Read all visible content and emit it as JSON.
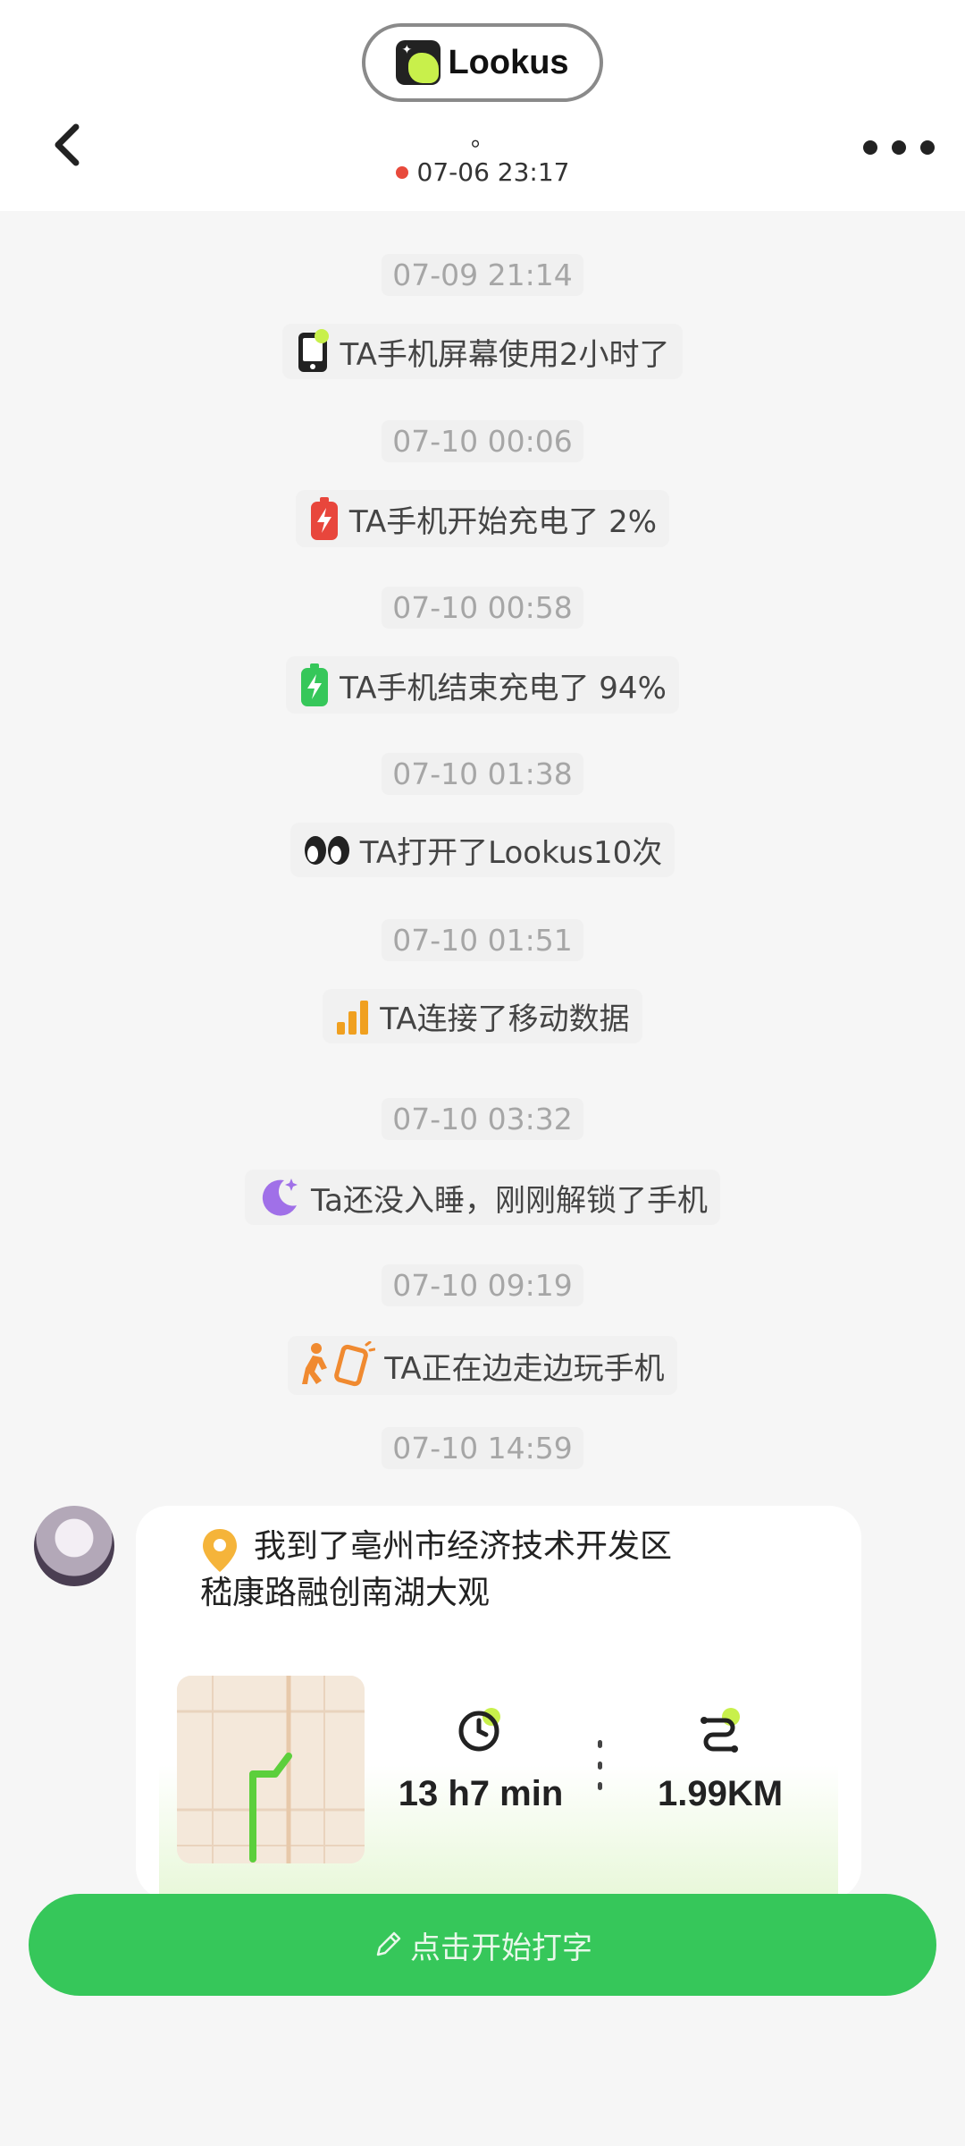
{
  "header": {
    "brand_name": "Lookus",
    "title": "。",
    "status_time": "07-06 23:17",
    "status_color": "#e84a3c"
  },
  "feed": [
    {
      "time": "07-09 21:14",
      "icon": "phone-screen-icon",
      "text": "TA手机屏幕使用2小时了"
    },
    {
      "time": "07-10 00:06",
      "icon": "battery-charging-red-icon",
      "text": "TA手机开始充电了 2%"
    },
    {
      "time": "07-10 00:58",
      "icon": "battery-charging-green-icon",
      "text": "TA手机结束充电了 94%"
    },
    {
      "time": "07-10 01:38",
      "icon": "eyes-icon",
      "text": "TA打开了Lookus10次"
    },
    {
      "time": "07-10 01:51",
      "icon": "signal-bars-icon",
      "text": "TA连接了移动数据"
    },
    {
      "time": "07-10 03:32",
      "icon": "moon-icon",
      "text": "Ta还没入睡，刚刚解锁了手机"
    },
    {
      "time": "07-10 09:19",
      "icon": "walking-phone-icon",
      "text": "TA正在边走边玩手机"
    }
  ],
  "card": {
    "time": "07-10 14:59",
    "location": "我到了亳州市经济技术开发区嵇康路融创南湖大观",
    "duration": "13 h7 min",
    "distance": "1.99KM"
  },
  "input": {
    "placeholder": "点击开始打字"
  },
  "colors": {
    "accent_green": "#36c75a",
    "lime": "#c8f04b",
    "background": "#f6f6f6"
  }
}
